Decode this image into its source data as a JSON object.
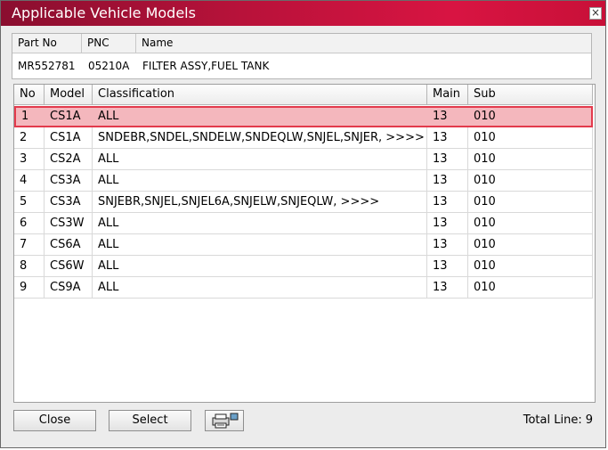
{
  "window": {
    "title": "Applicable Vehicle Models",
    "close_glyph": "×"
  },
  "part": {
    "headers": [
      "Part No",
      "PNC",
      "Name"
    ],
    "values": [
      "MR552781",
      "05210A",
      "FILTER ASSY,FUEL TANK"
    ]
  },
  "grid": {
    "columns": [
      "No",
      "Model",
      "Classification",
      "Main",
      "Sub"
    ],
    "selected_index": 0,
    "rows": [
      [
        "1",
        "CS1A",
        "ALL",
        "13",
        "010"
      ],
      [
        "2",
        "CS1A",
        "SNDEBR,SNDEL,SNDELW,SNDEQLW,SNJEL,SNJER,   >>>>",
        "13",
        "010"
      ],
      [
        "3",
        "CS2A",
        "ALL",
        "13",
        "010"
      ],
      [
        "4",
        "CS3A",
        "ALL",
        "13",
        "010"
      ],
      [
        "5",
        "CS3A",
        "SNJEBR,SNJEL,SNJEL6A,SNJELW,SNJEQLW,   >>>>",
        "13",
        "010"
      ],
      [
        "6",
        "CS3W",
        "ALL",
        "13",
        "010"
      ],
      [
        "7",
        "CS6A",
        "ALL",
        "13",
        "010"
      ],
      [
        "8",
        "CS6W",
        "ALL",
        "13",
        "010"
      ],
      [
        "9",
        "CS9A",
        "ALL",
        "13",
        "010"
      ]
    ]
  },
  "buttons": {
    "close": "Close",
    "select": "Select",
    "print_icon": "printer-icon"
  },
  "footer": {
    "total_label": "Total Line:",
    "total_value": "9"
  },
  "colors": {
    "title_bar": "#c81038",
    "selection_fill": "#f4b7bd",
    "selection_border": "#e33a4c"
  }
}
